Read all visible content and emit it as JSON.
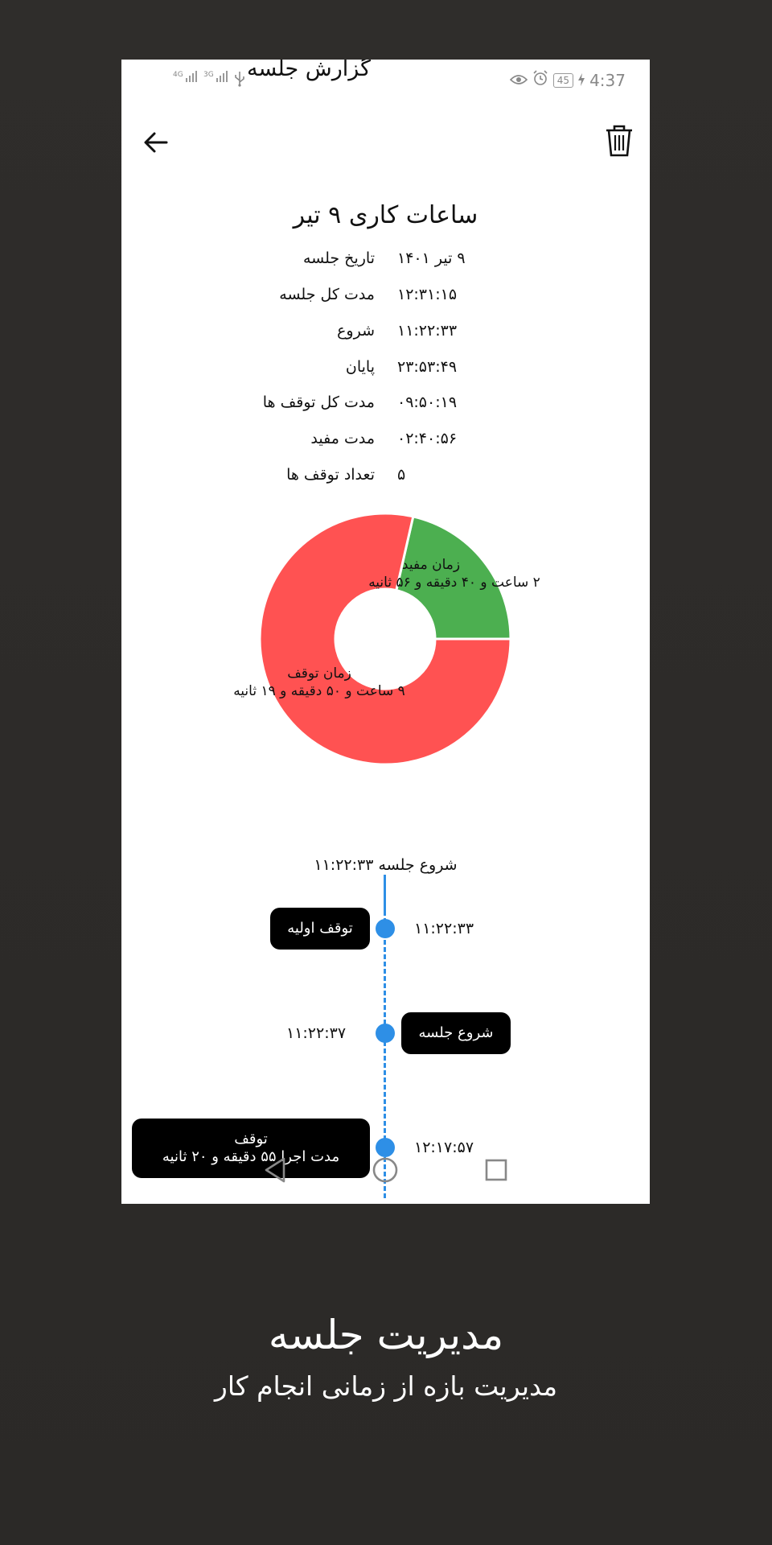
{
  "status_bar": {
    "signal_1": "4G",
    "signal_2": "3G",
    "battery": "45",
    "time": "4:37"
  },
  "app_bar": {
    "title": "گزارش جلسه"
  },
  "report": {
    "title": "ساعات کاری ۹ تیر",
    "rows": [
      {
        "label": "تاریخ جلسه",
        "value": "۹ تیر ۱۴۰۱"
      },
      {
        "label": "مدت کل جلسه",
        "value": "۱۲:۳۱:۱۵"
      },
      {
        "label": "شروع",
        "value": "۱۱:۲۲:۳۳"
      },
      {
        "label": "پایان",
        "value": "۲۳:۵۳:۴۹"
      },
      {
        "label": "مدت کل توقف ها",
        "value": "۰۹:۵۰:۱۹"
      },
      {
        "label": "مدت مفید",
        "value": "۰۲:۴۰:۵۶"
      },
      {
        "label": "تعداد توقف ها",
        "value": "۵"
      }
    ]
  },
  "chart_data": {
    "type": "pie",
    "categories": [
      "زمان مفید",
      "زمان توقف"
    ],
    "values": [
      9656,
      35419
    ],
    "labels": [
      {
        "name": "زمان مفید",
        "detail": "۲ ساعت و ۴۰ دقیقه و ۵۶ ثانیه"
      },
      {
        "name": "زمان توقف",
        "detail": "۹ ساعت و ۵۰ دقیقه و ۱۹ ثانیه"
      }
    ],
    "colors": [
      "#4caf50",
      "#ff5252"
    ],
    "donut": true
  },
  "timeline": {
    "start_label": "شروع جلسه ۱۱:۲۲:۳۳",
    "events": [
      {
        "pill": "توقف اولیه",
        "time": "۱۱:۲۲:۳۳"
      },
      {
        "pill": "شروع جلسه",
        "time": "۱۱:۲۲:۳۷"
      },
      {
        "pill_title": "توقف",
        "pill_detail": "مدت اجرا ۵۵ دقیقه و ۲۰ ثانیه",
        "time": "۱۲:۱۷:۵۷"
      }
    ],
    "line_color": "#2e8fe6"
  },
  "promo": {
    "title": "مدیریت جلسه",
    "subtitle": "مدیریت بازه از زمانی انجام کار"
  }
}
